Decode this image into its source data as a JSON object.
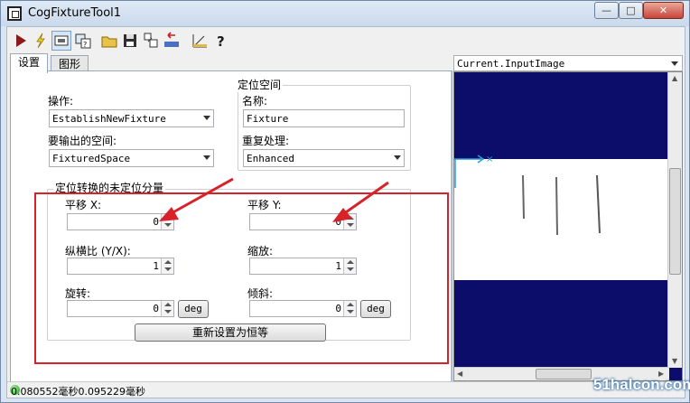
{
  "window": {
    "title": "CogFixtureTool1",
    "min": "—",
    "max": "□",
    "close": "✕"
  },
  "toolbar": {
    "icons": [
      "run-icon",
      "lightning-icon",
      "show-image-icon",
      "help-panel-icon",
      "open-folder-icon",
      "save-icon",
      "import-icon",
      "reset-icon",
      "ruler-icon",
      "help-icon"
    ]
  },
  "tabs": [
    "设置",
    "图形"
  ],
  "settings": {
    "operation_label": "操作:",
    "operation_value": "EstablishNewFixture",
    "output_space_label": "要输出的空间:",
    "output_space_value": "FixturedSpace",
    "fixture_space_group": "定位空间",
    "name_label": "名称:",
    "name_value": "Fixture",
    "reprocess_label": "重复处理:",
    "reprocess_value": "Enhanced",
    "transform_group": "定位转换的未定位分量",
    "translate_x_label": "平移 X:",
    "translate_x_value": "0",
    "translate_y_label": "平移 Y:",
    "translate_y_value": "0",
    "aspect_label": "纵横比 (Y/X):",
    "aspect_value": "1",
    "scale_label": "缩放:",
    "scale_value": "1",
    "rotation_label": "旋转:",
    "rotation_value": "0",
    "rotation_unit": "deg",
    "skew_label": "倾斜:",
    "skew_value": "0",
    "skew_unit": "deg",
    "reset_button": "重新设置为恒等"
  },
  "display": {
    "image_source": "Current.InputImage"
  },
  "status": {
    "text": "0.080552毫秒0.095229毫秒"
  },
  "watermark": "51halcon.com",
  "colors": {
    "highlight": "#d8222a",
    "image_bg": "#0c0c6a",
    "annotation": "#d8222a"
  }
}
